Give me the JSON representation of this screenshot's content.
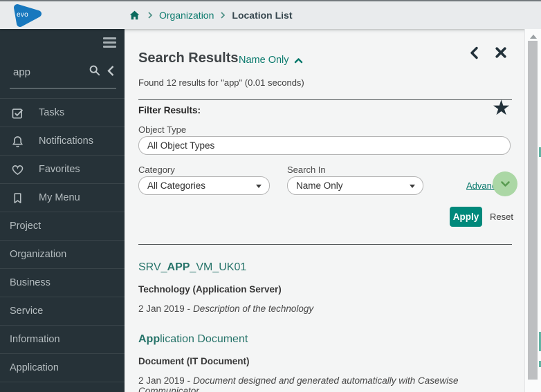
{
  "colors": {
    "accent": "#0b7a6d",
    "link": "#27746a",
    "apply-bg": "#00897b",
    "sidebar-bg": "#263238",
    "topbar-bg": "#e9ebed",
    "content-bg": "#f4f5f5",
    "advanced-circle": "#abd7a5",
    "divider-dark": "#4d5254"
  },
  "topbar": {
    "logo_text": "evo",
    "breadcrumb": {
      "items": [
        "Organization",
        "Location List"
      ]
    }
  },
  "sidebar": {
    "search_value": "app",
    "items": [
      {
        "label": "Tasks",
        "icon": "tasks-checkbox-icon"
      },
      {
        "label": "Notifications",
        "icon": "notifications-bell-icon"
      },
      {
        "label": "Favorites",
        "icon": "favorites-heart-icon"
      },
      {
        "label": "My Menu",
        "icon": "my-menu-bookmark-icon"
      },
      {
        "label": "Project"
      },
      {
        "label": "Organization"
      },
      {
        "label": "Business"
      },
      {
        "label": "Service"
      },
      {
        "label": "Information"
      },
      {
        "label": "Application"
      }
    ]
  },
  "main": {
    "title": "Search Results",
    "scope_label": "Name Only",
    "summary": "Found 12 results for \"app\" (0.01 seconds)",
    "filter": {
      "heading": "Filter Results:",
      "star_icon": "favorite-filter-star-icon",
      "object_type_label": "Object Type",
      "object_type_value": "All Object Types",
      "category_label": "Category",
      "category_value": "All Categories",
      "search_in_label": "Search In",
      "search_in_value": "Name Only",
      "advanced_label": "Advanced",
      "apply_label": "Apply",
      "reset_label": "Reset"
    },
    "results": [
      {
        "name_pre": "SRV_",
        "name_bold": "APP",
        "name_post": "_VM_UK01",
        "type": "Technology (Application Server)",
        "meta_prefix": "2 Jan 2019 -",
        "description": "Description of the technology"
      },
      {
        "name_pre": "",
        "name_bold": "App",
        "name_post": "lication Document",
        "type": "Document (IT Document)",
        "meta_prefix": "2 Jan 2019 -",
        "description": "Document designed and generated automatically with Casewise Communicator"
      }
    ]
  }
}
